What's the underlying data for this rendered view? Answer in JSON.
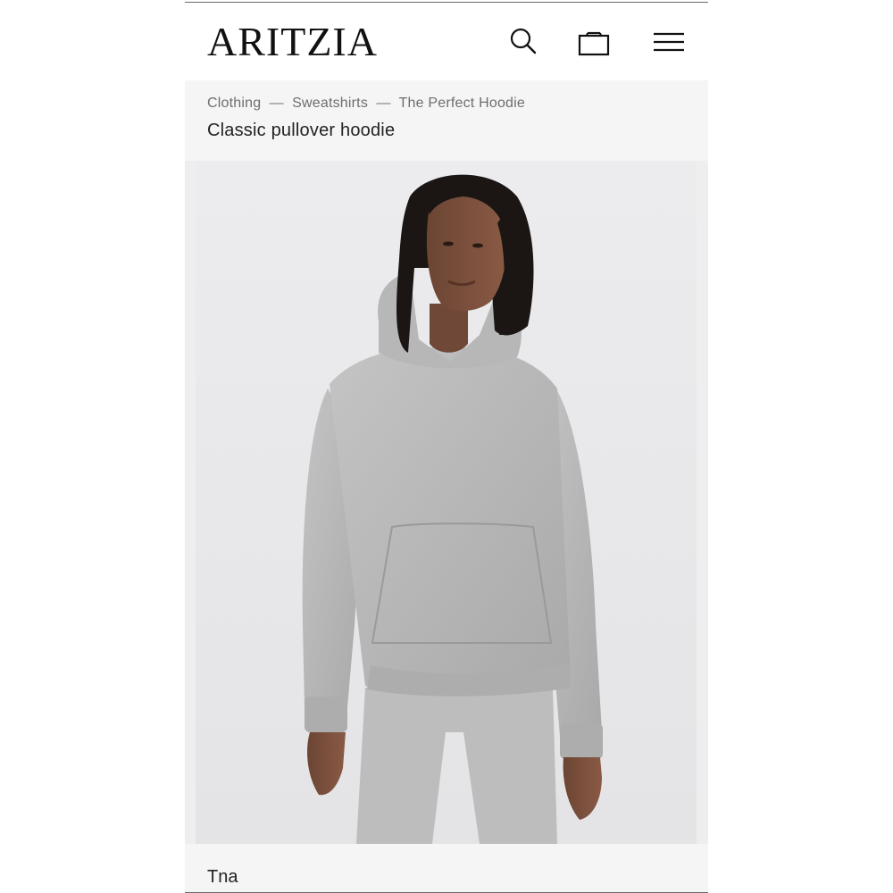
{
  "header": {
    "logo": "ARITZIA",
    "icons": [
      "search-icon",
      "shopping-bag-icon",
      "menu-icon"
    ]
  },
  "breadcrumb": {
    "items": [
      "Clothing",
      "Sweatshirts",
      "The Perfect Hoodie"
    ],
    "separator": "—"
  },
  "product": {
    "title": "Classic pullover hoodie",
    "brand": "Tna",
    "image": "model-wearing-grey-hoodie"
  },
  "colors": {
    "hoodie": "#b9b9ba",
    "background": "#e9e9eb",
    "panel": "#f5f5f5"
  }
}
